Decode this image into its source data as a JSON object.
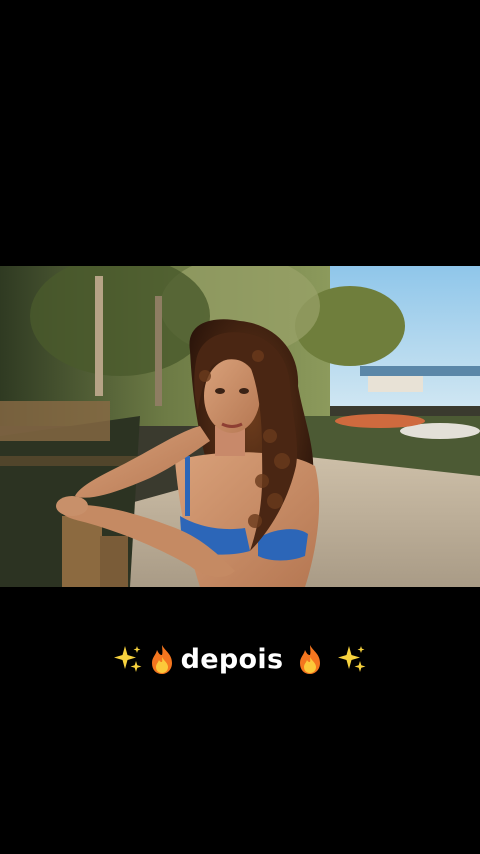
{
  "caption": {
    "text": "depois",
    "left_icons": [
      "sparkles-icon",
      "fire-icon"
    ],
    "right_icons": [
      "fire-icon",
      "sparkles-icon"
    ]
  },
  "colors": {
    "background": "#000000",
    "caption_text": "#ffffff",
    "sparkles": "#f7d23e",
    "fire": "#f4761f"
  }
}
